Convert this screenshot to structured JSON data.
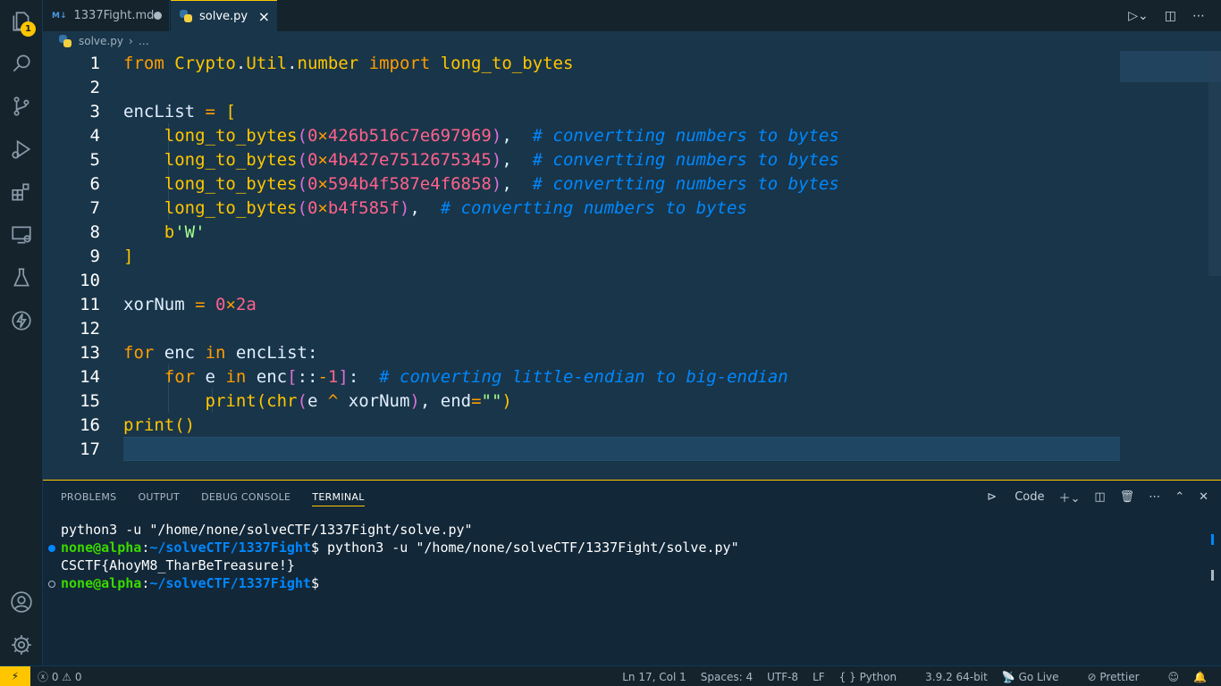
{
  "activity": {
    "explorer_badge": "1"
  },
  "tabs": [
    {
      "icon": "M↓",
      "label": "1337Fight.md"
    },
    {
      "label": "solve.py"
    }
  ],
  "breadcrumb": {
    "file": "solve.py",
    "rest": "…"
  },
  "editor": {
    "line_numbers": [
      "1",
      "2",
      "3",
      "4",
      "5",
      "6",
      "7",
      "8",
      "9",
      "10",
      "11",
      "12",
      "13",
      "14",
      "15",
      "16",
      "17"
    ]
  },
  "panel": {
    "tabs": [
      "PROBLEMS",
      "OUTPUT",
      "DEBUG CONSOLE",
      "TERMINAL"
    ],
    "shell_label": "Code",
    "terminal": {
      "line1": "python3 -u \"/home/none/solveCTF/1337Fight/solve.py\"",
      "prompt_user": "none@alpha",
      "prompt_colon": ":",
      "prompt_path": "~/solveCTF/1337Fight",
      "prompt_dollar": "$",
      "command": " python3 -u \"/home/none/solveCTF/1337Fight/solve.py\"",
      "output": "CSCTF{AhoyM8_TharBeTreasure!}"
    }
  },
  "status": {
    "errors": "0",
    "warnings": "0",
    "position": "Ln 17, Col 1",
    "spaces": "Spaces: 4",
    "encoding": "UTF-8",
    "eol": "LF",
    "language": "Python",
    "interpreter": "3.9.2 64-bit",
    "golive": "Go Live",
    "prettier": "Prettier"
  }
}
